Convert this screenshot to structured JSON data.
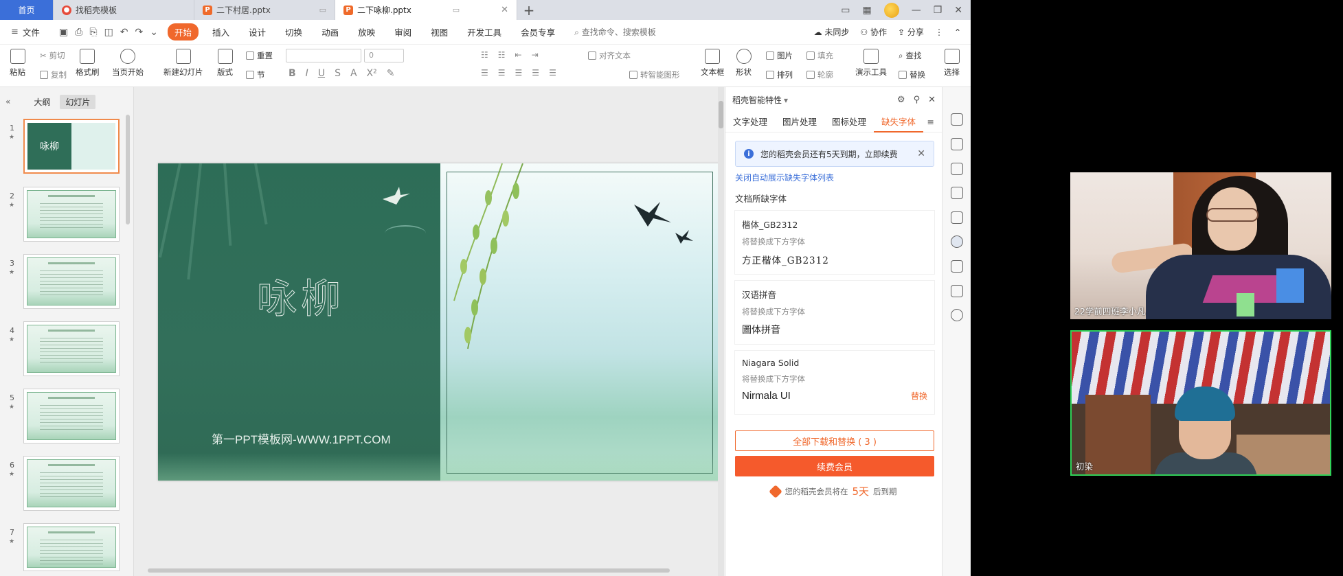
{
  "tabs": [
    {
      "label": "首页",
      "type": "home"
    },
    {
      "label": "找稻壳模板",
      "type": "docer"
    },
    {
      "label": "二下村居.pptx",
      "type": "ppt"
    },
    {
      "label": "二下咏柳.pptx",
      "type": "ppt",
      "active": true
    }
  ],
  "menubar": {
    "file": "文件",
    "items": [
      "开始",
      "插入",
      "设计",
      "切换",
      "动画",
      "放映",
      "审阅",
      "视图",
      "开发工具",
      "会员专享"
    ],
    "search": "查找命令、搜索模板",
    "unsync": "未同步",
    "collab": "协作",
    "share": "分享"
  },
  "ribbon": {
    "paste": "粘贴",
    "cut": "剪切",
    "copy": "复制",
    "format_painter": "格式刷",
    "play_current": "当页开始",
    "new_slide": "新建幻灯片",
    "layout": "版式",
    "reset": "重置",
    "section": "节",
    "font_size": "0",
    "align_text": "对齐文本",
    "to_smartart": "转智能图形",
    "textbox": "文本框",
    "shape": "形状",
    "picture": "图片",
    "fill": "填充",
    "arrange": "排列",
    "outline": "轮廓",
    "present_tools": "演示工具",
    "find": "查找",
    "replace": "替换",
    "select": "选择"
  },
  "leftpanel": {
    "tab_outline": "大纲",
    "tab_slides": "幻灯片",
    "thumb_title": "咏柳",
    "slide_numbers": [
      "1",
      "2",
      "3",
      "4",
      "5",
      "6",
      "7"
    ]
  },
  "slide": {
    "title": "咏柳",
    "subtitle": "第一PPT模板网-WWW.1PPT.COM"
  },
  "rpanel": {
    "header": "稻壳智能特性",
    "tabs": [
      "文字处理",
      "图片处理",
      "图标处理",
      "缺失字体"
    ],
    "notice": "您的稻壳会员还有5天到期，立即续费",
    "link": "关闭自动展示缺失字体列表",
    "section": "文档所缺字体",
    "hint": "将替换成下方字体",
    "fonts": [
      {
        "name": "楷体_GB2312",
        "replace": "方正楷体_GB2312",
        "action": ""
      },
      {
        "name": "汉语拼音",
        "replace": "圖体拼音",
        "action": ""
      },
      {
        "name": "Niagara Solid",
        "replace": "Nirmala UI",
        "action": "替换"
      }
    ],
    "btn_all": "全部下载和替换 ( 3 )",
    "btn_renew": "续费会员",
    "expire_pre": "您的稻壳会员将在",
    "expire_days": "5天",
    "expire_post": "后到期"
  },
  "video": {
    "user1": "22学前四班李小凡",
    "user2": "初染"
  },
  "colors": {
    "accent": "#f0682c",
    "home_tab": "#3b6fd9",
    "slide_green": "#2d6d57"
  }
}
